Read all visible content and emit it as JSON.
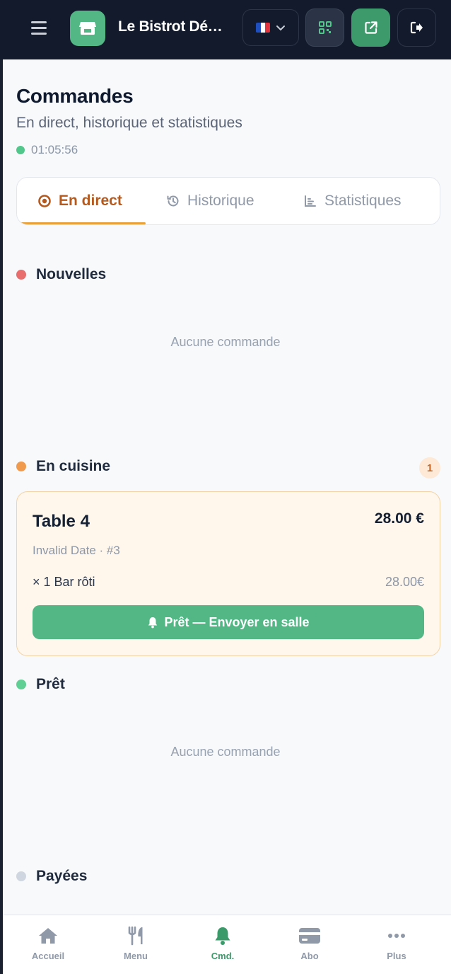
{
  "header": {
    "title": "Le Bistrot Dé…",
    "language": {
      "flag_colors": [
        "#1f4fbf",
        "#ffffff",
        "#e2323c"
      ]
    }
  },
  "page": {
    "title": "Commandes",
    "subtitle": "En direct, historique et statistiques",
    "clock": "01:05:56"
  },
  "tabs": [
    {
      "label": "En direct",
      "icon": "live-icon",
      "active": true
    },
    {
      "label": "Historique",
      "icon": "history-icon",
      "active": false
    },
    {
      "label": "Statistiques",
      "icon": "chart-icon",
      "active": false
    }
  ],
  "sections": {
    "new": {
      "label": "Nouvelles",
      "color": "#e86d6d",
      "empty_text": "Aucune commande"
    },
    "kitchen": {
      "label": "En cuisine",
      "color": "#f09a4d",
      "count": "1"
    },
    "ready": {
      "label": "Prêt",
      "color": "#5fcf93",
      "empty_text": "Aucune commande"
    },
    "paid": {
      "label": "Payées",
      "color": "#cfd6e0"
    }
  },
  "order": {
    "table": "Table 4",
    "total": "28.00 €",
    "meta": "Invalid Date · #3",
    "items": [
      {
        "label": "× 1 Bar rôti",
        "price": "28.00€"
      }
    ],
    "action_label": "Prêt — Envoyer en salle"
  },
  "nav": [
    {
      "label": "Accueil",
      "icon": "home-icon",
      "active": false
    },
    {
      "label": "Menu",
      "icon": "utensils-icon",
      "active": false
    },
    {
      "label": "Cmd.",
      "icon": "bell-icon",
      "active": true
    },
    {
      "label": "Abo",
      "icon": "card-icon",
      "active": false
    },
    {
      "label": "Plus",
      "icon": "more-icon",
      "active": false
    }
  ],
  "colors": {
    "brand_green": "#52b785",
    "accent_orange": "#b45a1f",
    "header_bg": "#121a2b"
  }
}
